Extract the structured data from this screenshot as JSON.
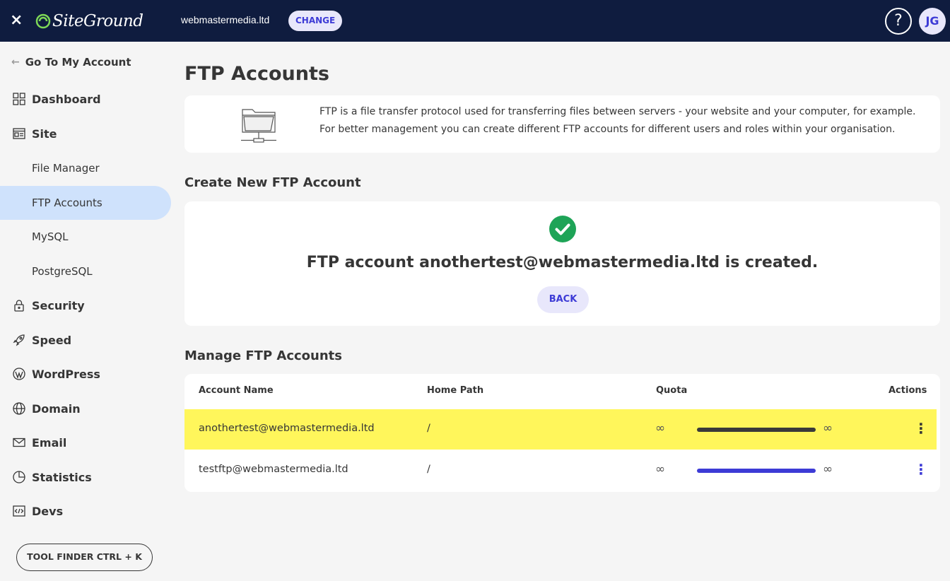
{
  "topbar": {
    "close_label": "×",
    "logo_text": "SiteGround",
    "site_name": "webmastermedia.ltd",
    "change_label": "CHANGE",
    "help_label": "?",
    "avatar_initials": "JG"
  },
  "sidebar": {
    "goto_label": "Go To My Account",
    "items": [
      {
        "label": "Dashboard",
        "icon": "grid-icon"
      },
      {
        "label": "Site",
        "icon": "site-icon"
      },
      {
        "label": "File Manager"
      },
      {
        "label": "FTP Accounts",
        "active": true
      },
      {
        "label": "MySQL"
      },
      {
        "label": "PostgreSQL"
      },
      {
        "label": "Security",
        "icon": "lock-icon"
      },
      {
        "label": "Speed",
        "icon": "rocket-icon"
      },
      {
        "label": "WordPress",
        "icon": "wordpress-icon"
      },
      {
        "label": "Domain",
        "icon": "globe-icon"
      },
      {
        "label": "Email",
        "icon": "envelope-icon"
      },
      {
        "label": "Statistics",
        "icon": "pie-chart-icon"
      },
      {
        "label": "Devs",
        "icon": "code-icon"
      }
    ],
    "tool_finder_label": "TOOL FINDER CTRL + K"
  },
  "main": {
    "title": "FTP Accounts",
    "intro_text": "FTP is a file transfer protocol used for transferring files between servers - your website and your computer, for example. For better management you can create different FTP accounts for different users and roles within your organisation.",
    "create_section_title": "Create New FTP Account",
    "created_message": "FTP account anothertest@webmastermedia.ltd is created.",
    "back_label": "BACK",
    "manage_section_title": "Manage FTP Accounts",
    "table": {
      "headers": [
        "Account Name",
        "Home Path",
        "Quota",
        "Actions"
      ],
      "rows": [
        {
          "account": "anothertest@webmastermedia.ltd",
          "path": "/",
          "quota_used": "∞",
          "quota_total": "∞",
          "highlighted": true,
          "bar_color": "#3a3a3a"
        },
        {
          "account": "testftp@webmastermedia.ltd",
          "path": "/",
          "quota_used": "∞",
          "quota_total": "∞",
          "highlighted": false,
          "bar_color": "#3d3bd6"
        }
      ]
    }
  },
  "colors": {
    "topbar_bg": "#0f1c3f",
    "accent": "#3d3bd6",
    "active_nav_bg": "#cfe2fc",
    "highlight_row": "#fff65b",
    "success": "#1ea457",
    "logo_green": "#7ed957"
  }
}
